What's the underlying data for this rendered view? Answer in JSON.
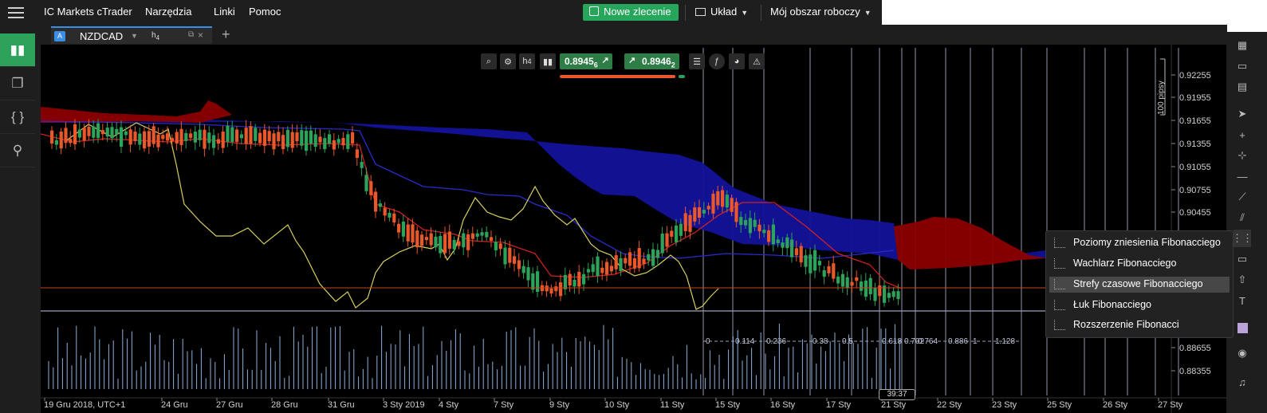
{
  "app": {
    "menu": [
      "IC Markets cTrader",
      "Narzędzia",
      "Linki",
      "Pomoc"
    ],
    "new_order_label": "Nowe zlecenie",
    "layout_label": "Układ",
    "workspace_label": "Mój obszar roboczy"
  },
  "tab": {
    "badge": "A",
    "symbol": "NZDCAD",
    "timeframe": "h",
    "timeframe_sub": "4",
    "add_label": "+"
  },
  "quotes": {
    "sell_main": "0.8945",
    "sell_pip": "6",
    "buy_main": "0.8946",
    "buy_pip": "2"
  },
  "price_axis": [
    "0.92255",
    "0.91955",
    "0.91655",
    "0.91355",
    "0.91055",
    "0.90755",
    "0.90455",
    "0.88655",
    "0.88355"
  ],
  "pips_label": "100 pipsy",
  "time_axis": [
    "19 Gru 2018, UTC+1",
    "24 Gru",
    "27 Gru",
    "28 Gru",
    "31 Gru",
    "3 Sty 2019",
    "4 Sty",
    "7 Sty",
    "9 Sty",
    "10 Sty",
    "11 Sty",
    "15 Sty",
    "16 Sty",
    "17 Sty",
    "21 Sty",
    "22 Sty",
    "23 Sty",
    "25 Sty",
    "26 Sty",
    "27 Sty"
  ],
  "fib_levels": [
    "0",
    "0.114",
    "0.236",
    "0.38",
    "0.5",
    "0.618",
    "0.702",
    "0.764",
    "0.886",
    "1",
    "1.128"
  ],
  "countdown": "39:37",
  "fib_menu": [
    "Poziomy zniesienia Fibonacciego",
    "Wachlarz Fibonacciego",
    "Strefy czasowe Fibonacciego",
    "Łuk Fibonacciego",
    "Rozszerzenie Fibonacci"
  ],
  "colors": {
    "buy": "#2e7d46",
    "bull_candle": "#2ca25a",
    "bear_candle": "#e8582a",
    "cloud_blue": "#12129a",
    "cloud_red": "#8b0000",
    "tenkan": "#d02020",
    "kijun": "#2a2acc",
    "chikou": "#d8d060"
  }
}
